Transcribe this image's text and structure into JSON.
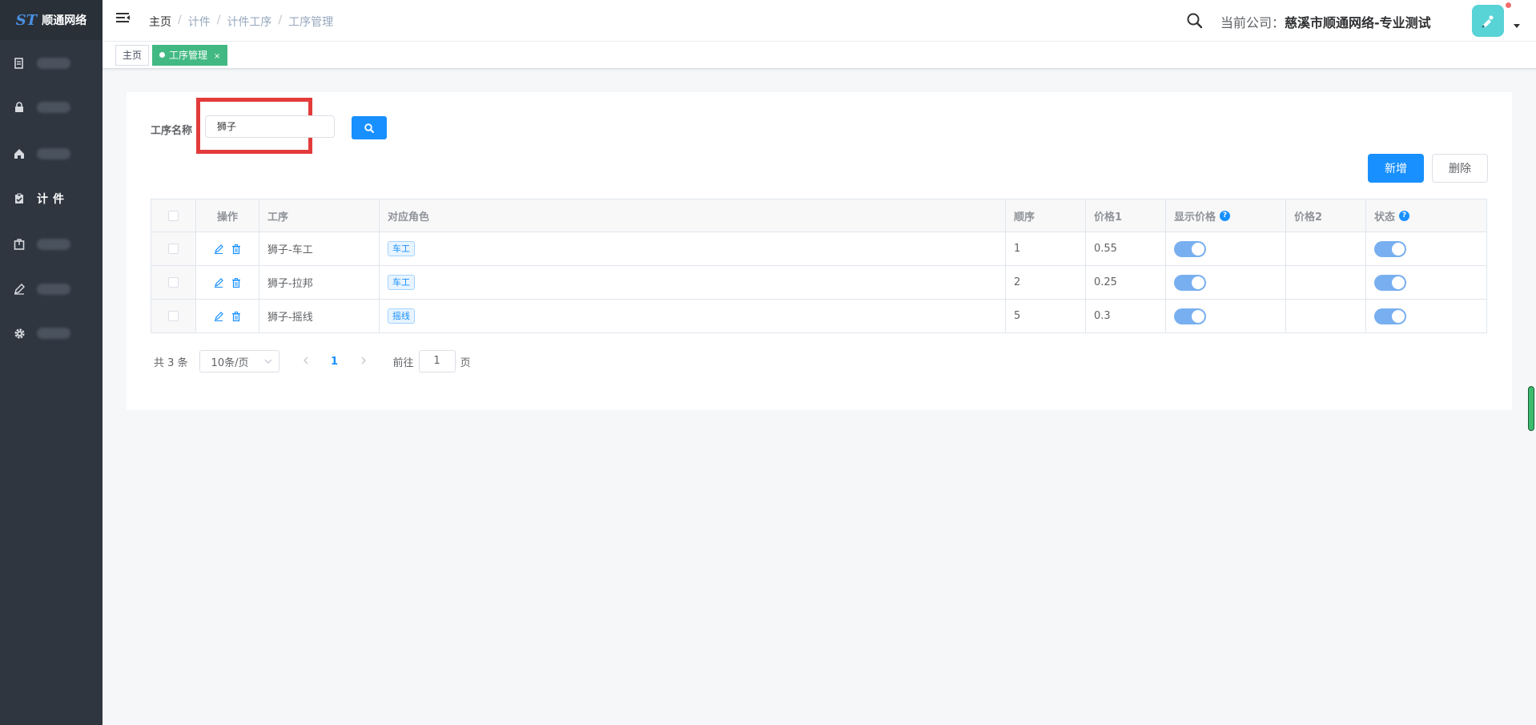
{
  "logo": {
    "mark": "ST",
    "name": "顺通网络"
  },
  "sidebar": {
    "items": [
      {
        "icon": "document-icon",
        "label": ""
      },
      {
        "icon": "lock-icon",
        "label": ""
      },
      {
        "icon": "home-icon",
        "label": ""
      },
      {
        "icon": "clipboard-icon",
        "label": "计件"
      },
      {
        "icon": "package-icon",
        "label": ""
      },
      {
        "icon": "edit-icon",
        "label": ""
      },
      {
        "icon": "gear-icon",
        "label": ""
      }
    ]
  },
  "header": {
    "breadcrumb": [
      "主页",
      "计件",
      "计件工序",
      "工序管理"
    ],
    "breadcrumb_sep": "/",
    "company_prefix": "当前公司：",
    "company_name": "慈溪市顺通网络-专业测试"
  },
  "tags": [
    {
      "label": "主页",
      "active": false
    },
    {
      "label": "工序管理",
      "active": true,
      "close": "×"
    }
  ],
  "search": {
    "label": "工序名称",
    "value": "狮子"
  },
  "toolbar": {
    "add_label": "新增",
    "delete_label": "删除"
  },
  "table": {
    "headers": [
      "操作",
      "工序",
      "对应角色",
      "顺序",
      "价格1",
      "显示价格",
      "价格2",
      "状态"
    ],
    "rows": [
      {
        "name": "狮子-车工",
        "role": "车工",
        "order": "1",
        "price1": "0.55",
        "show_price": true,
        "price2": "",
        "status": true
      },
      {
        "name": "狮子-拉邦",
        "role": "车工",
        "order": "2",
        "price1": "0.25",
        "show_price": true,
        "price2": "",
        "status": true
      },
      {
        "name": "狮子-摇线",
        "role": "摇线",
        "order": "5",
        "price1": "0.3",
        "show_price": true,
        "price2": "",
        "status": true
      }
    ]
  },
  "pagination": {
    "total_text": "共 3 条",
    "page_size": "10条/页",
    "current_page": "1",
    "goto_prefix": "前往",
    "goto_value": "1",
    "goto_suffix": "页"
  },
  "colors": {
    "primary": "#1890ff",
    "sidebar": "#2f3640",
    "active_tag": "#42b983",
    "highlight": "#e33b3b"
  }
}
